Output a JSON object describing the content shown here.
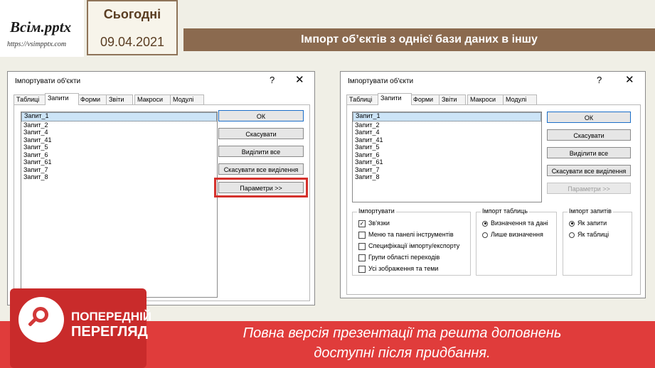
{
  "header": {
    "logo_text": "Всім.pptx",
    "logo_url": "https://vsimpptx.com",
    "today_label": "Сьогодні",
    "date": "09.04.2021",
    "slide_title": "Імпорт об’єктів з однієї бази даних в іншу"
  },
  "dialog_left": {
    "title": "Імпортувати об'єкти",
    "help": "?",
    "close": "✕",
    "tabs": [
      "Таблиці",
      "Запити",
      "Форми",
      "Звіти",
      "Макроси",
      "Модулі"
    ],
    "items": [
      "Запит_1",
      "Запит_2",
      "Запит_4",
      "Запит_41",
      "Запит_5",
      "Запит_6",
      "Запит_61",
      "Запит_7",
      "Запит_8"
    ],
    "buttons": {
      "ok": "ОК",
      "cancel": "Скасувати",
      "select_all": "Виділити все",
      "deselect_all": "Скасувати все виділення",
      "options": "Параметри >>"
    }
  },
  "dialog_right": {
    "title": "Імпортувати об'єкти",
    "help": "?",
    "close": "✕",
    "tabs": [
      "Таблиці",
      "Запити",
      "Форми",
      "Звіти",
      "Макроси",
      "Модулі"
    ],
    "items": [
      "Запит_1",
      "Запит_2",
      "Запит_4",
      "Запит_41",
      "Запит_5",
      "Запит_6",
      "Запит_61",
      "Запит_7",
      "Запит_8"
    ],
    "buttons": {
      "ok": "ОК",
      "cancel": "Скасувати",
      "select_all": "Виділити все",
      "deselect_all": "Скасувати все виділення",
      "options": "Параметри >>"
    },
    "import_group": {
      "title": "Імпортувати",
      "options": [
        "Зв'язки",
        "Меню та панелі інструментів",
        "Специфікації імпорту/експорту",
        "Групи області переходів",
        "Усі зображення та теми"
      ],
      "checked": [
        true,
        false,
        false,
        false,
        false
      ]
    },
    "tables_group": {
      "title": "Імпорт таблиць",
      "options": [
        "Визначення та дані",
        "Лише визначення"
      ],
      "selected": 0
    },
    "queries_group": {
      "title": "Імпорт запитів",
      "options": [
        "Як запити",
        "Як таблиці"
      ],
      "selected": 0
    }
  },
  "footer": {
    "preview_line1": "ПОПЕРЕДНІЙ",
    "preview_line2": "ПЕРЕГЛЯД",
    "message_line1": "Повна версія презентації та решта доповнень",
    "message_line2": "доступні після придбання."
  }
}
